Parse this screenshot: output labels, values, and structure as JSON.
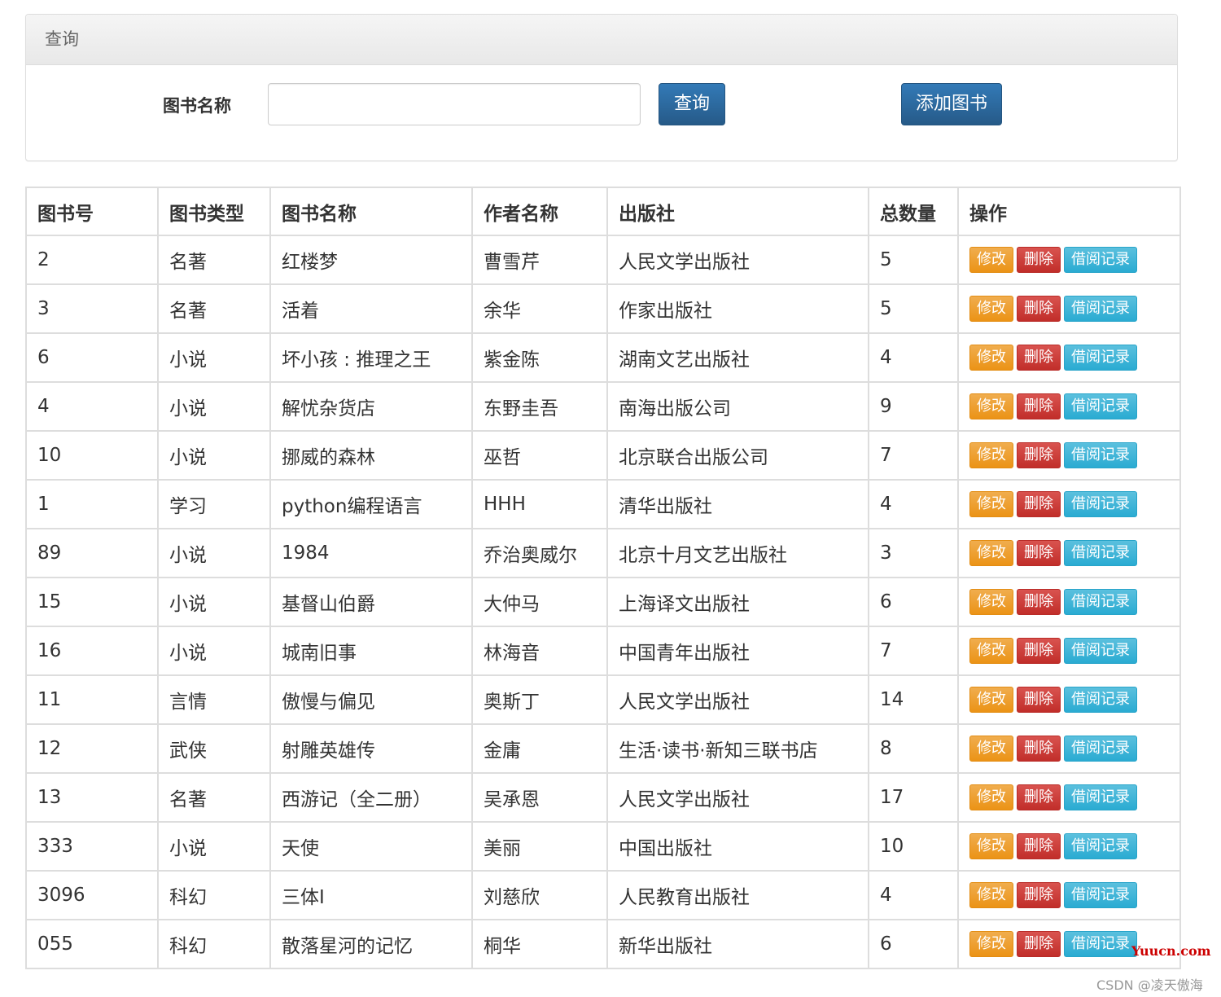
{
  "panel": {
    "title": "查询"
  },
  "search": {
    "label": "图书名称",
    "value": "",
    "placeholder": "",
    "search_button": "查询",
    "add_button": "添加图书"
  },
  "table": {
    "headers": [
      "图书号",
      "图书类型",
      "图书名称",
      "作者名称",
      "出版社",
      "总数量",
      "操作"
    ],
    "actions": {
      "edit": "修改",
      "delete": "删除",
      "records": "借阅记录"
    },
    "rows": [
      [
        "2",
        "名著",
        "红楼梦",
        "曹雪芹",
        "人民文学出版社",
        "5"
      ],
      [
        "3",
        "名著",
        "活着",
        "余华",
        "作家出版社",
        "5"
      ],
      [
        "6",
        "小说",
        "坏小孩 : 推理之王",
        "紫金陈",
        "湖南文艺出版社",
        "4"
      ],
      [
        "4",
        "小说",
        "解忧杂货店",
        "东野圭吾",
        "南海出版公司",
        "9"
      ],
      [
        "10",
        "小说",
        "挪威的森林",
        "巫哲",
        "北京联合出版公司",
        "7"
      ],
      [
        "1",
        "学习",
        "python编程语言",
        "HHH",
        "清华出版社",
        "4"
      ],
      [
        "89",
        "小说",
        "1984",
        "乔治奥威尔",
        "北京十月文艺出版社",
        "3"
      ],
      [
        "15",
        "小说",
        "基督山伯爵",
        "大仲马",
        "上海译文出版社",
        "6"
      ],
      [
        "16",
        "小说",
        "城南旧事",
        "林海音",
        "中国青年出版社",
        "7"
      ],
      [
        "11",
        "言情",
        "傲慢与偏见",
        "奥斯丁",
        "人民文学出版社",
        "14"
      ],
      [
        "12",
        "武侠",
        "射雕英雄传",
        "金庸",
        "生活·读书·新知三联书店",
        "8"
      ],
      [
        "13",
        "名著",
        "西游记（全二册）",
        "吴承恩",
        "人民文学出版社",
        "17"
      ],
      [
        "333",
        "小说",
        "天使",
        "美丽",
        "中国出版社",
        "10"
      ],
      [
        "3096",
        "科幻",
        "三体I",
        "刘慈欣",
        "人民教育出版社",
        "4"
      ],
      [
        "055",
        "科幻",
        "散落星河的记忆",
        "桐华",
        "新华出版社",
        "6"
      ]
    ]
  },
  "watermarks": {
    "site": "Yuucn.com",
    "csdn": "CSDN @凌天傲海"
  },
  "colors": {
    "primary": "#337ab7",
    "warning": "#f0ad4e",
    "danger": "#d9534f",
    "info": "#5bc0de"
  }
}
